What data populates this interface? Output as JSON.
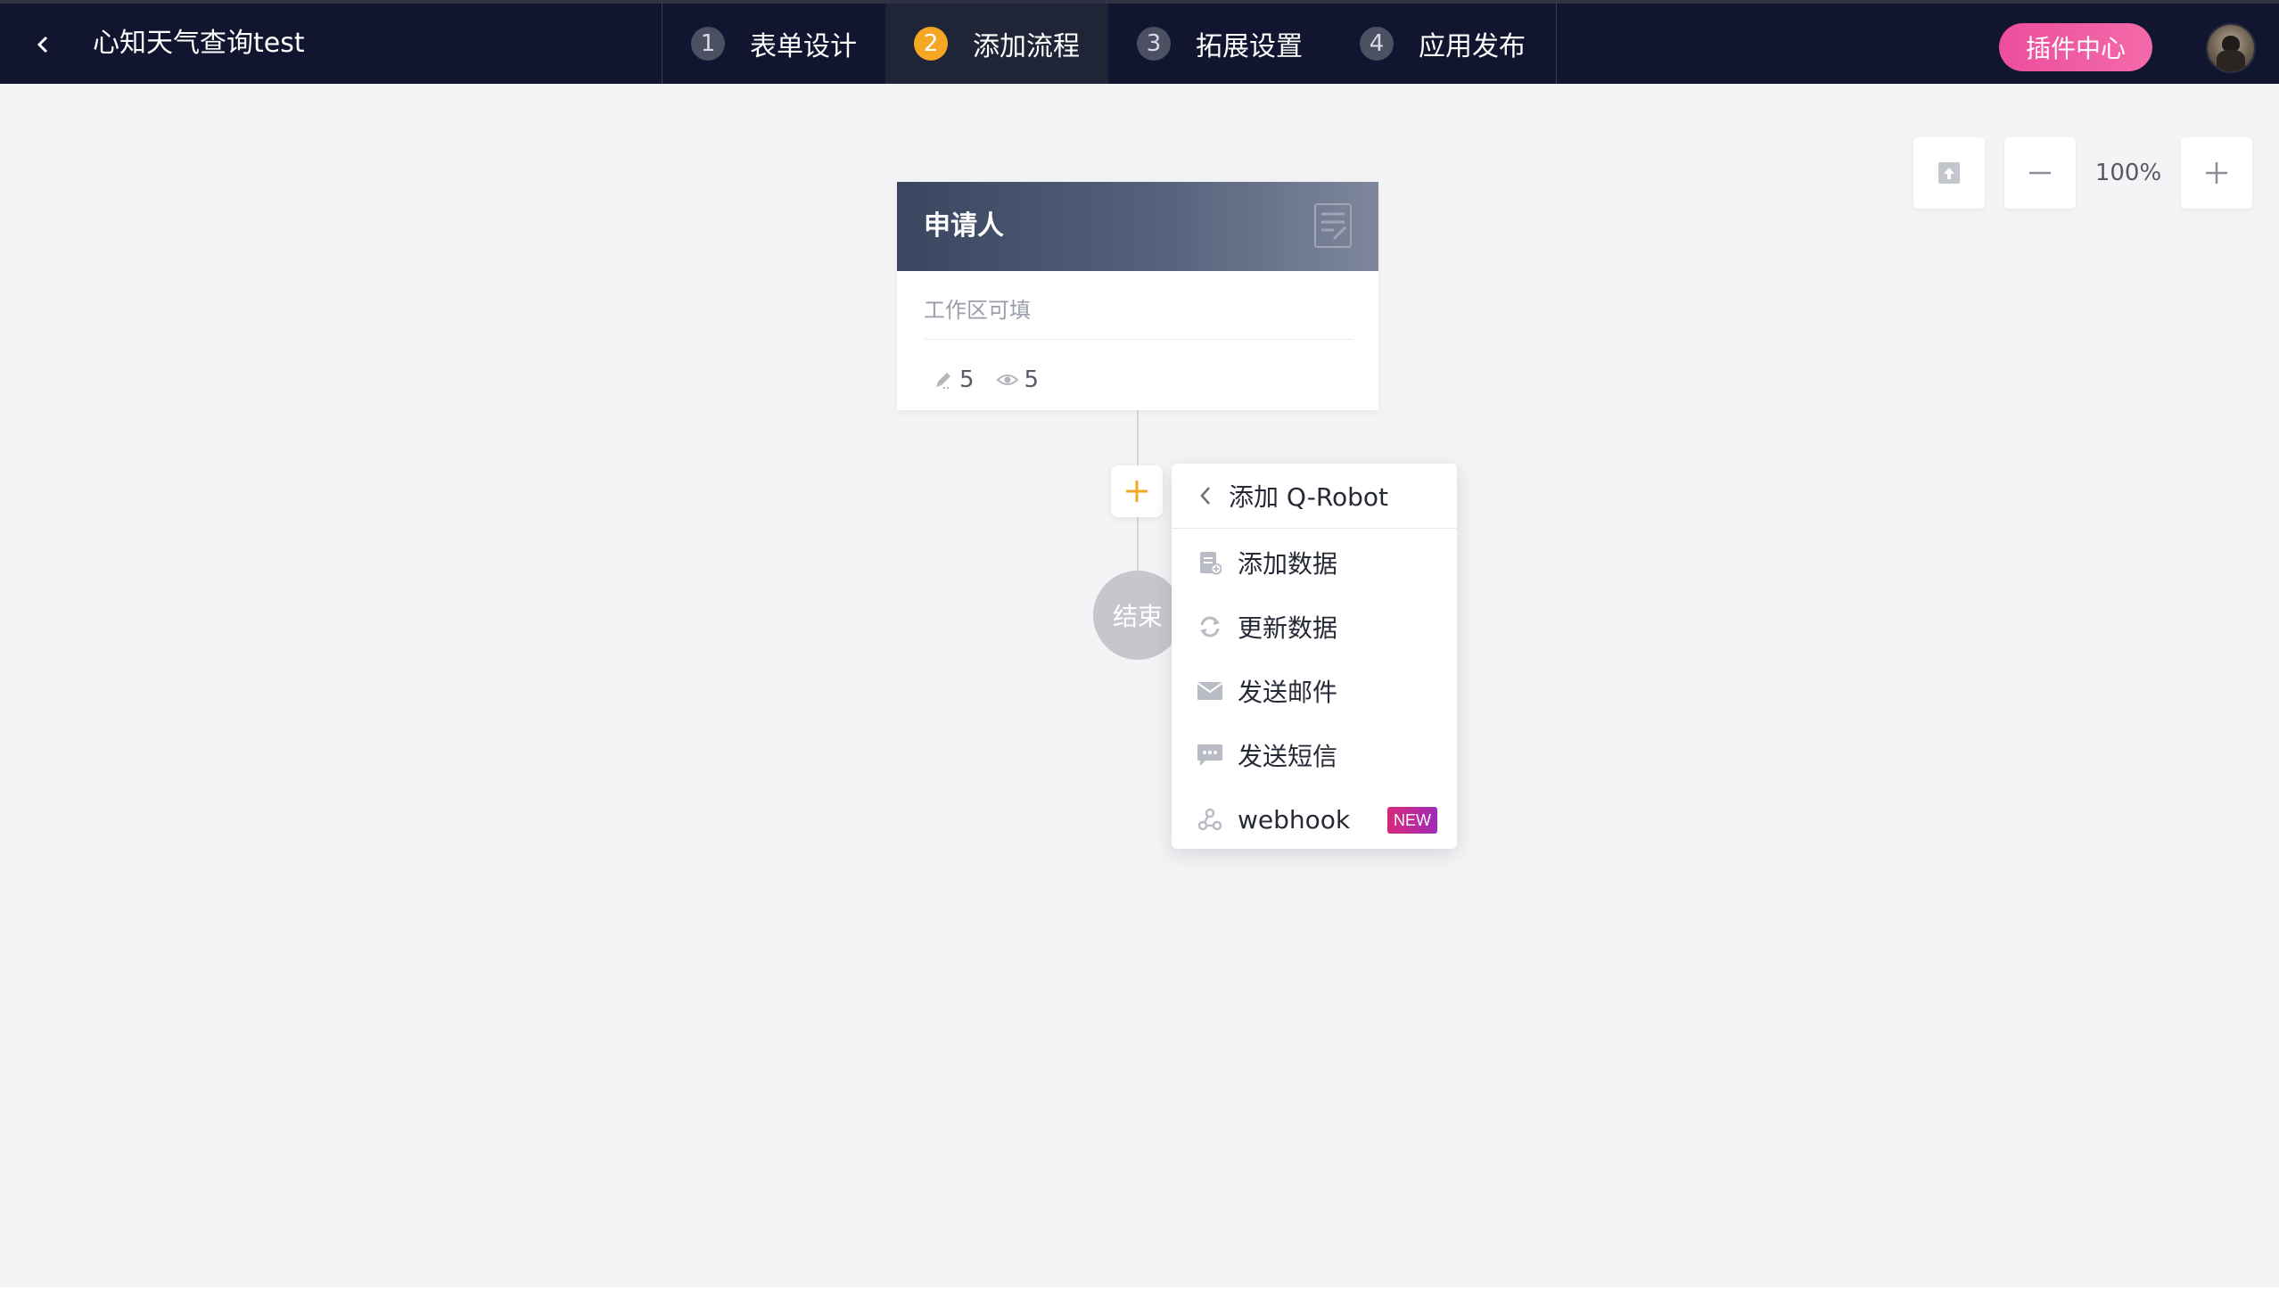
{
  "header": {
    "app_title": "心知天气查询test",
    "steps": [
      {
        "num": "1",
        "label": "表单设计"
      },
      {
        "num": "2",
        "label": "添加流程"
      },
      {
        "num": "3",
        "label": "拓展设置"
      },
      {
        "num": "4",
        "label": "应用发布"
      }
    ],
    "active_step": 2,
    "plugin_center_label": "插件中心"
  },
  "zoom": {
    "level": "100%"
  },
  "applicant_card": {
    "title": "申请人",
    "description": "工作区可填",
    "edit_count": "5",
    "view_count": "5"
  },
  "end_node": {
    "label": "结束"
  },
  "add_menu": {
    "title": "添加 Q-Robot",
    "items": [
      {
        "label": "添加数据",
        "icon": "add-data-icon"
      },
      {
        "label": "更新数据",
        "icon": "refresh-icon"
      },
      {
        "label": "发送邮件",
        "icon": "mail-icon"
      },
      {
        "label": "发送短信",
        "icon": "sms-icon"
      },
      {
        "label": "webhook",
        "icon": "webhook-icon",
        "badge": "NEW"
      }
    ]
  },
  "colors": {
    "topbar_bg": "#111530",
    "active_step_badge": "#f5a623",
    "plugin_button": "#ec4e9c",
    "add_node_plus": "#f5a623",
    "new_badge": "#d7297a"
  }
}
